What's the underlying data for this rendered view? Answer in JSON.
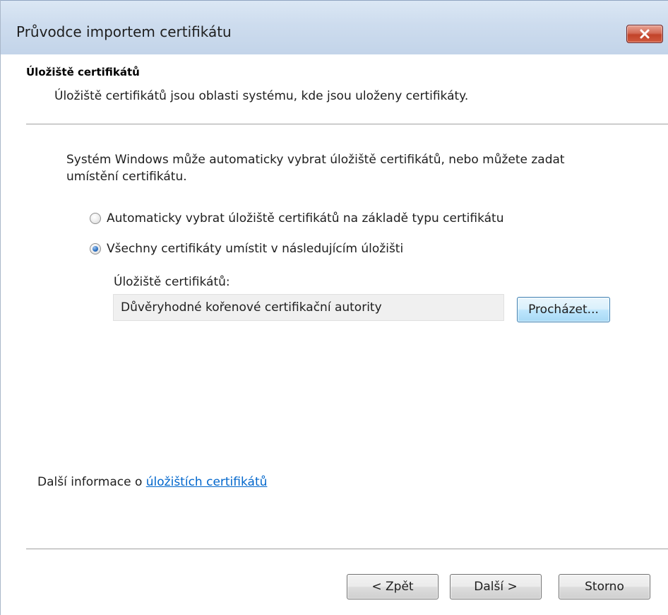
{
  "window": {
    "title": "Průvodce importem certifikátu",
    "close_label": "×"
  },
  "header": {
    "title": "Úložiště certifikátů",
    "description": "Úložiště certifikátů jsou oblasti systému, kde jsou uloženy certifikáty."
  },
  "body": {
    "intro": "Systém Windows může automaticky vybrat úložiště certifikátů, nebo můžete zadat umístění certifikátu.",
    "options": [
      {
        "label": "Automaticky vybrat úložiště certifikátů na základě typu certifikátu",
        "selected": false
      },
      {
        "label": "Všechny certifikáty umístit v následujícím úložišti",
        "selected": true
      }
    ],
    "store_label": "Úložiště certifikátů:",
    "store_value": "Důvěryhodné kořenové certifikační autority",
    "browse_label": "Procházet..."
  },
  "info": {
    "prefix": "Další informace o ",
    "link": "úložištích certifikátů"
  },
  "footer": {
    "back_label": "< Zpět",
    "next_label": "Další >",
    "cancel_label": "Storno"
  },
  "colors": {
    "link": "#0066cc",
    "titlebar": "#cddcee",
    "close_button": "#c2432a",
    "radio_selected": "#2b6fc0"
  }
}
